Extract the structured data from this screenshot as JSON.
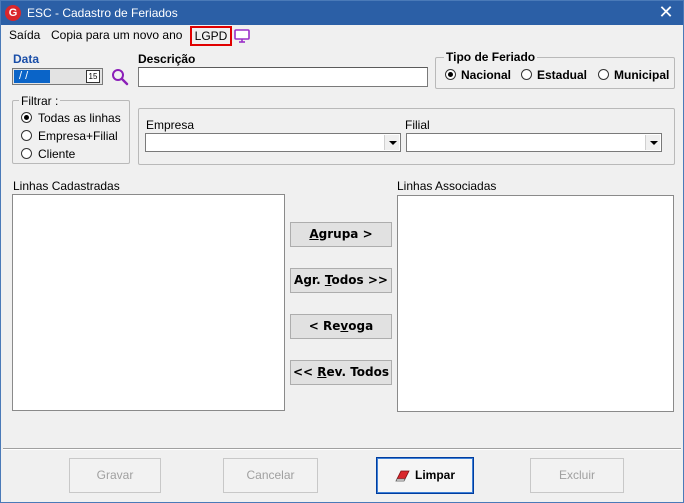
{
  "window": {
    "title": "ESC - Cadastro de Feriados",
    "close_glyph": "✕",
    "app_icon": "app-logo-icon",
    "app_icon_letter": "G"
  },
  "menu": {
    "saida": "Saída",
    "copia": "Copia para um novo ano",
    "lgpd": "LGPD",
    "lgpd_icon": "monitor-icon"
  },
  "form": {
    "data_label": "Data",
    "date_value": "/ /",
    "calendar_glyph": "15",
    "descricao_label": "Descrição",
    "descricao_value": "",
    "tipo_label": "Tipo de Feriado",
    "tipo_options": [
      "Nacional",
      "Estadual",
      "Municipal"
    ],
    "tipo_selected": "Nacional",
    "filtrar_label": "Filtrar :",
    "filtrar_options": [
      "Todas as linhas",
      "Empresa+Filial",
      "Cliente"
    ],
    "filtrar_selected": "Todas as linhas",
    "empresa_label": "Empresa",
    "empresa_value": "",
    "filial_label": "Filial",
    "filial_value": ""
  },
  "lists": {
    "cadastradas_label": "Linhas Cadastradas",
    "associadas_label": "Linhas Associadas"
  },
  "middle_buttons": {
    "agrupa": {
      "pre": "",
      "ul": "A",
      "post": "grupa >"
    },
    "agr_todos": {
      "pre": "Agr. ",
      "ul": "T",
      "post": "odos >>"
    },
    "revoga": {
      "pre": "< Re",
      "ul": "v",
      "post": "oga"
    },
    "rev_todos": {
      "pre": "<< ",
      "ul": "R",
      "post": "ev. Todos"
    }
  },
  "bottom_buttons": {
    "gravar": "Gravar",
    "cancelar": "Cancelar",
    "limpar": "Limpar",
    "excluir": "Excluir"
  },
  "colors": {
    "title_bar": "#2b5fa6",
    "accent_blue": "#1a4ea8",
    "lgpd_border": "#e00000",
    "date_selection": "#0a64c8",
    "magnifier": "#8b1fb8",
    "eraser": "#d9262c"
  }
}
